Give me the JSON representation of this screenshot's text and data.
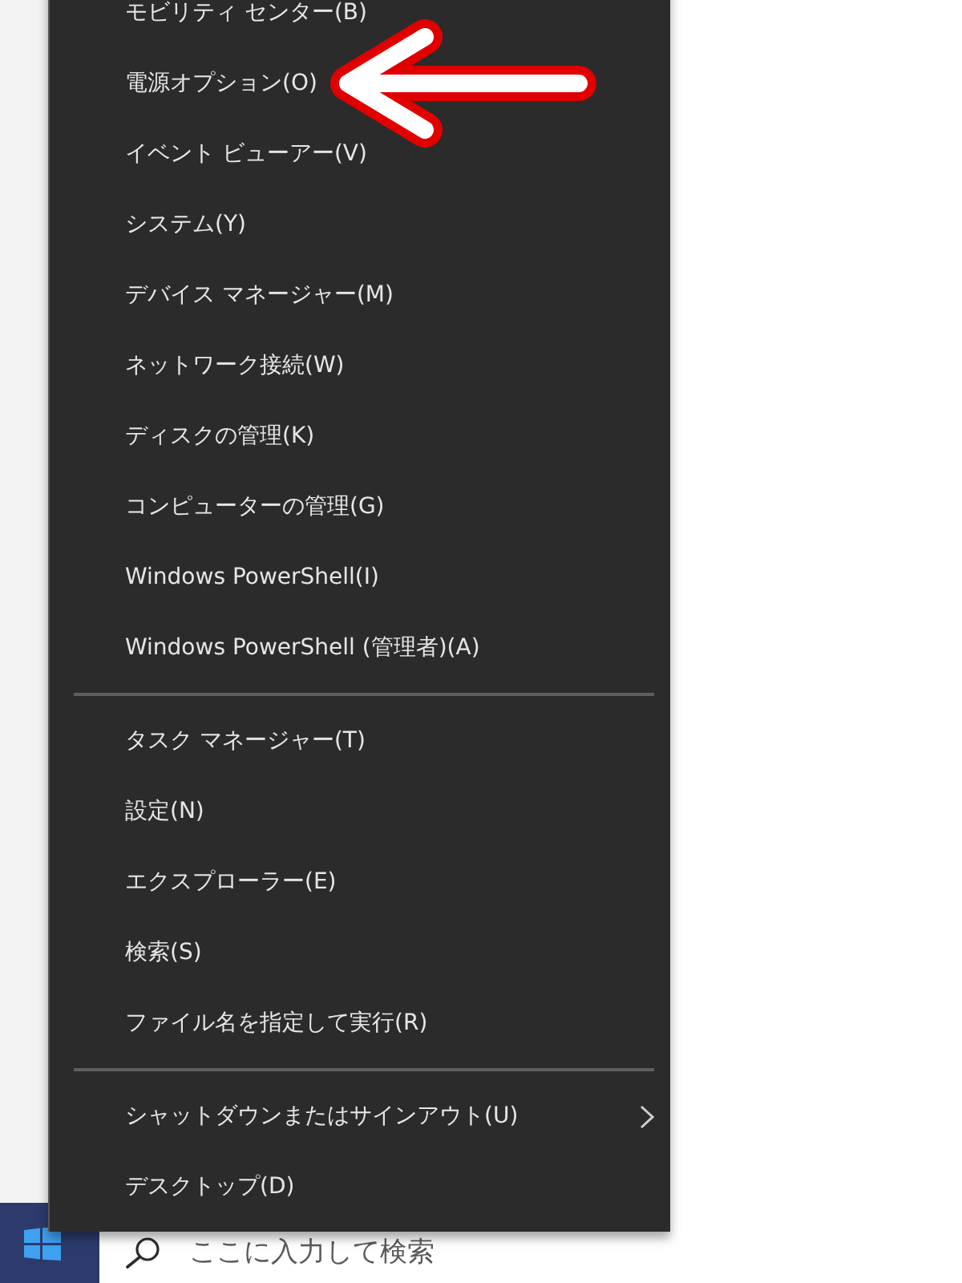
{
  "menu": {
    "groups": [
      {
        "items": [
          {
            "label": "モビリティ センター(B)",
            "submenu": false,
            "marked": false
          },
          {
            "label": "電源オプション(O)",
            "submenu": false,
            "marked": true
          },
          {
            "label": "イベント ビューアー(V)",
            "submenu": false,
            "marked": false
          },
          {
            "label": "システム(Y)",
            "submenu": false,
            "marked": false
          },
          {
            "label": "デバイス マネージャー(M)",
            "submenu": false,
            "marked": false
          },
          {
            "label": "ネットワーク接続(W)",
            "submenu": false,
            "marked": false
          },
          {
            "label": "ディスクの管理(K)",
            "submenu": false,
            "marked": false
          },
          {
            "label": "コンピューターの管理(G)",
            "submenu": false,
            "marked": false
          },
          {
            "label": "Windows PowerShell(I)",
            "submenu": false,
            "marked": false
          },
          {
            "label": "Windows PowerShell (管理者)(A)",
            "submenu": false,
            "marked": false
          }
        ]
      },
      {
        "items": [
          {
            "label": "タスク マネージャー(T)",
            "submenu": false,
            "marked": false
          },
          {
            "label": "設定(N)",
            "submenu": false,
            "marked": false
          },
          {
            "label": "エクスプローラー(E)",
            "submenu": false,
            "marked": false
          },
          {
            "label": "検索(S)",
            "submenu": false,
            "marked": false
          },
          {
            "label": "ファイル名を指定して実行(R)",
            "submenu": false,
            "marked": false
          }
        ]
      },
      {
        "items": [
          {
            "label": "シャットダウンまたはサインアウト(U)",
            "submenu": true,
            "marked": false
          },
          {
            "label": "デスクトップ(D)",
            "submenu": false,
            "marked": false
          }
        ]
      }
    ]
  },
  "taskbar": {
    "search": {
      "placeholder": "ここに入力して検索"
    }
  }
}
